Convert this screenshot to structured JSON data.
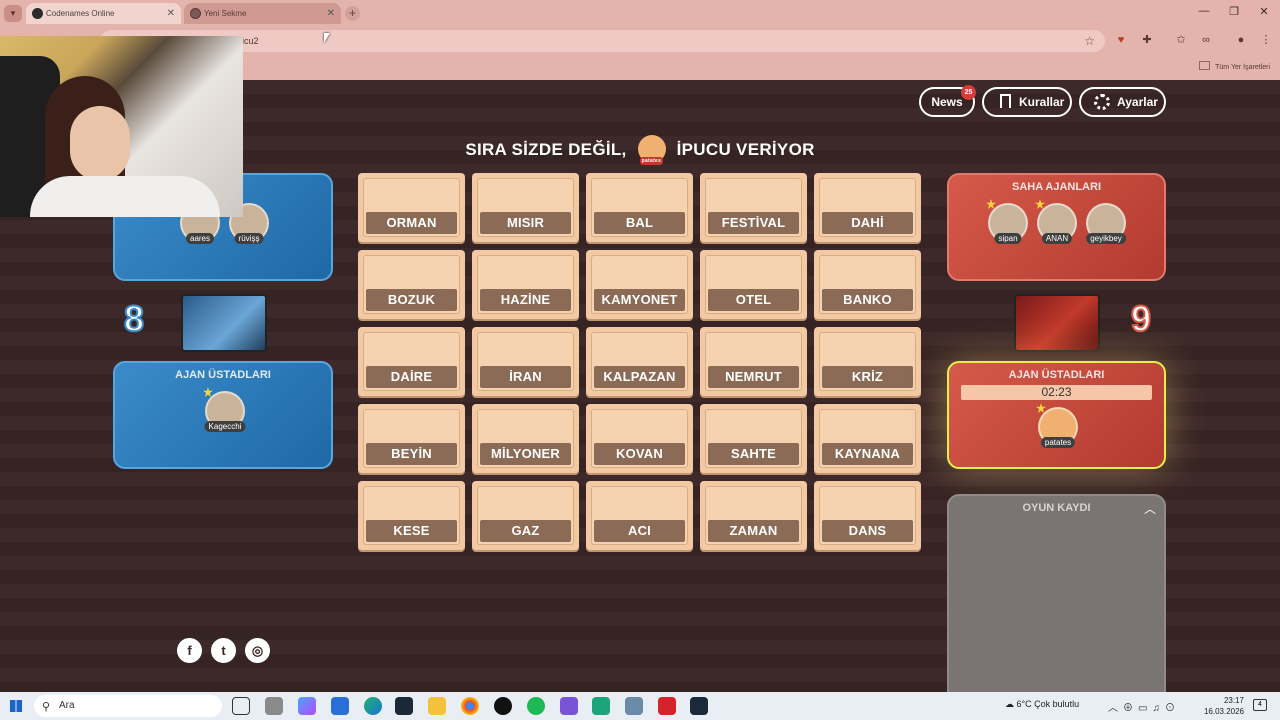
{
  "browser": {
    "tabs": [
      {
        "label": "Codenames Online"
      },
      {
        "label": "Yeni Sekme"
      }
    ],
    "url": "jicu2",
    "bookmarks_all": "Tüm Yer İşaretleri"
  },
  "header": {
    "news_label": "News",
    "news_count": "25",
    "rules_label": "Kurallar",
    "settings_label": "Ayarlar"
  },
  "status": {
    "prefix": "SIRA SİZDE DEĞİL,",
    "player_tag": "patates",
    "suffix": "İPUCU VERİYOR"
  },
  "board": {
    "rows": [
      [
        "ORMAN",
        "MISIR",
        "BAL",
        "FESTİVAL",
        "DAHİ"
      ],
      [
        "BOZUK",
        "HAZİNE",
        "KAMYONET",
        "OTEL",
        "BANKO"
      ],
      [
        "DAİRE",
        "İRAN",
        "KALPAZAN",
        "NEMRUT",
        "KRİZ"
      ],
      [
        "BEYİN",
        "MİLYONER",
        "KOVAN",
        "SAHTE",
        "KAYNANA"
      ],
      [
        "KESE",
        "GAZ",
        "ACI",
        "ZAMAN",
        "DANS"
      ]
    ]
  },
  "blue_team": {
    "operatives_title": "LARI",
    "operatives": [
      "aares",
      "rüvişş"
    ],
    "score": "8",
    "spymasters_title": "AJAN ÜSTADLARI",
    "spymasters": [
      "Kagecchi"
    ],
    "color": "#2a7bbf"
  },
  "red_team": {
    "operatives_title": "SAHA AJANLARI",
    "operatives": [
      "sipan",
      "ANAN",
      "geyikbey"
    ],
    "score": "9",
    "spymasters_title": "AJAN ÜSTADLARI",
    "timer": "02:23",
    "spymasters": [
      "patates"
    ],
    "color": "#c8463a"
  },
  "game_log": {
    "title": "OYUN KAYDI"
  },
  "taskbar": {
    "search_placeholder": "Ara",
    "weather": "6°C  Çok bulutlu",
    "time": "23:17",
    "date": "16.03.2026",
    "notification_count": "4"
  }
}
